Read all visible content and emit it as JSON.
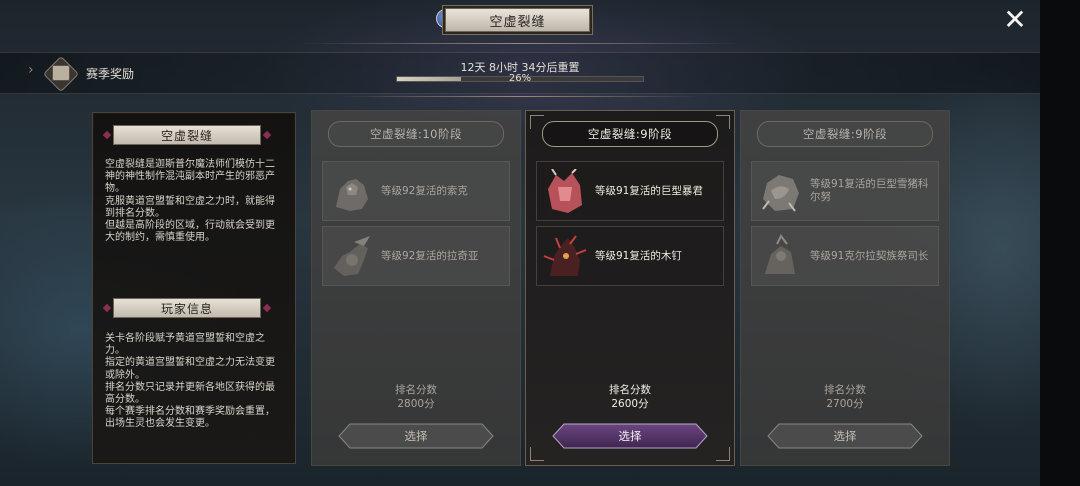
{
  "header": {
    "title": "空虚裂缝",
    "info_icon": "i"
  },
  "season": {
    "label": "赛季奖励",
    "reset_text": "12天 8小时 34分后重置",
    "progress_percent": 26,
    "progress_text": "26%"
  },
  "info_panel": {
    "section1_title": "空虚裂缝",
    "section1_text": "空虚裂缝是迦斯普尔魔法师们模仿十二\n神的神性制作混沌副本时产生的邪恶产\n物。\n克服黄道宫盟誓和空虚之力时，就能得\n到排名分数。\n但越是高阶段的区域，行动就会受到更\n大的制约，需慎重使用。",
    "section2_title": "玩家信息",
    "section2_text": "关卡各阶段赋予黄道宫盟誓和空虚之\n力。\n指定的黄道宫盟誓和空虚之力无法变更\n或除外。\n排名分数只记录并更新各地区获得的最\n高分数。\n每个赛季排名分数和赛季奖励会重置，\n出场生灵也会发生变更。"
  },
  "cards": [
    {
      "header": "空虚裂缝:10阶段",
      "bosses": [
        {
          "name": "等级92复活的索克",
          "icon": "beast-portrait-icon"
        },
        {
          "name": "等级92复活的拉奇亚",
          "icon": "warrior-portrait-icon"
        }
      ],
      "score_label": "",
      "score_value": "",
      "select_label": "选择"
    },
    {
      "header": "空虚裂缝:9阶段",
      "bosses": [
        {
          "name": "等级91复活的巨型暴君",
          "icon": "dragon-head-portrait-icon"
        },
        {
          "name": "等级91复活的木钉",
          "icon": "spiked-demon-portrait-icon"
        }
      ],
      "score_label": "排名分数",
      "score_value": "2600分",
      "select_label": "选择"
    },
    {
      "header": "空虚裂缝:9阶段",
      "bosses": [
        {
          "name": "等级91复活的巨型雪猪科尔努",
          "icon": "boar-portrait-icon"
        },
        {
          "name": "等级91克尔拉契族祭司长",
          "icon": "priest-portrait-icon"
        }
      ],
      "score_label": "排名分数",
      "score_value": "2700分",
      "select_label": "选择"
    }
  ],
  "first_card_score": {
    "label": "排名分数",
    "value": "2800分"
  },
  "colors": {
    "active_button": "#5a3a6e",
    "title_plate": "#e6e0d6",
    "accent_diamond": "#8a2f54"
  }
}
